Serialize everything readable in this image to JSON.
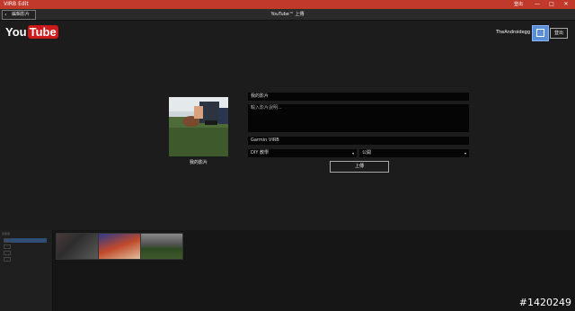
{
  "window": {
    "app_title": "VIRB Edit",
    "right_label": "登出",
    "controls": {
      "minimize": "—",
      "maximize": "□",
      "close": "✕"
    }
  },
  "toolbar": {
    "back_label": "編輯影片",
    "back_icon": "‹",
    "center_title": "YouTube™ 上傳"
  },
  "header": {
    "logo_you": "You",
    "logo_tube": "Tube",
    "username": "TheAndroidegg",
    "logout_label": "登出"
  },
  "video": {
    "thumbnail_caption": "我的影片"
  },
  "form": {
    "title_value": "我的影片",
    "description_placeholder": "輸入影片說明...",
    "tags_value": "Garmin VIRB",
    "category_value": "DIY 教學",
    "privacy_value": "公開",
    "caret": "▾",
    "upload_label": "上傳"
  },
  "library": {
    "header": "媒體庫"
  },
  "watermark": "#1420249",
  "colors": {
    "titlebar": "#c0392b",
    "youtube_red": "#cc1a1a",
    "avatar_blue": "#5a8fd8",
    "selection_blue": "#2f4d75"
  }
}
